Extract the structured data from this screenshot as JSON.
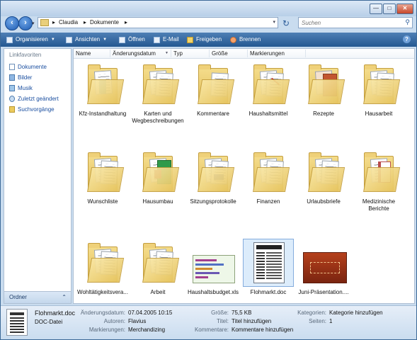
{
  "window": {
    "controls": [
      "—",
      "□",
      "✕"
    ]
  },
  "address": {
    "crumbs": [
      "Claudia",
      "Dokumente"
    ],
    "separator": "▸",
    "search_placeholder": "Suchen"
  },
  "toolbar": {
    "organize": "Organisieren",
    "views": "Ansichten",
    "open": "Öffnen",
    "email": "E-Mail",
    "share": "Freigeben",
    "burn": "Brennen",
    "help": "?"
  },
  "sidebar": {
    "heading": "Linkfavoriten",
    "items": [
      {
        "label": "Dokumente",
        "icon": "documents-icon"
      },
      {
        "label": "Bilder",
        "icon": "pictures-icon"
      },
      {
        "label": "Musik",
        "icon": "music-icon"
      },
      {
        "label": "Zuletzt geändert",
        "icon": "recent-icon"
      },
      {
        "label": "Suchvorgänge",
        "icon": "search-folder-icon"
      }
    ],
    "footer": "Ordner",
    "footer_caret": "⌃"
  },
  "columns": [
    "Name",
    "Änderungsdatum",
    "Typ",
    "Größe",
    "Markierungen"
  ],
  "items": [
    {
      "label": "Kfz-Instandhaltung",
      "kind": "folder"
    },
    {
      "label": "Karten und Wegbeschreibungen",
      "kind": "folder"
    },
    {
      "label": "Kommentare",
      "kind": "folder"
    },
    {
      "label": "Haushaltsmittel",
      "kind": "folder"
    },
    {
      "label": "Rezepte",
      "kind": "folder"
    },
    {
      "label": "Hausarbeit",
      "kind": "folder"
    },
    {
      "label": "Wunschliste",
      "kind": "folder"
    },
    {
      "label": "Hausumbau",
      "kind": "folder"
    },
    {
      "label": "Sitzungsprotokolle",
      "kind": "folder"
    },
    {
      "label": "Finanzen",
      "kind": "folder"
    },
    {
      "label": "Urlaubsbriefe",
      "kind": "folder"
    },
    {
      "label": "Medizinische Berichte",
      "kind": "folder"
    },
    {
      "label": "Wohltätigkeitsvera...",
      "kind": "folder"
    },
    {
      "label": "Arbeit",
      "kind": "folder"
    },
    {
      "label": "Haushaltsbudget.xls",
      "kind": "spreadsheet"
    },
    {
      "label": "Flohmarkt.doc",
      "kind": "document",
      "selected": true
    },
    {
      "label": "Juni-Präsentation....",
      "kind": "presentation"
    }
  ],
  "details": {
    "filename": "Flohmarkt.doc",
    "filetype": "DOC-Datei",
    "fields": [
      {
        "key": "Änderungsdatum:",
        "value": "07.04.2005 10:15"
      },
      {
        "key": "Autoren:",
        "value": "Flavius"
      },
      {
        "key": "Markierungen:",
        "value": "Merchandizing"
      },
      {
        "key": "Größe:",
        "value": "75,5 KB"
      },
      {
        "key": "Titel:",
        "value": "Titel hinzufügen"
      },
      {
        "key": "Kommentare:",
        "value": "Kommentare hinzufügen"
      },
      {
        "key": "Kategorien:",
        "value": "Kategorie hinzufügen"
      },
      {
        "key": "Seiten:",
        "value": "1"
      }
    ]
  }
}
